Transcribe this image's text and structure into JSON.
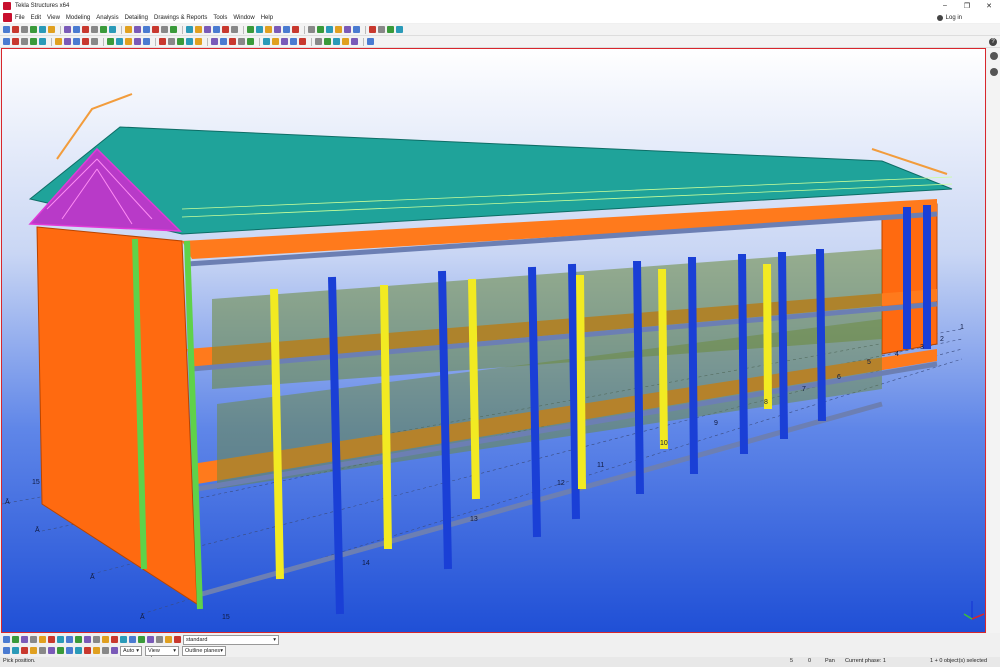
{
  "window": {
    "title": "Tekla Structures x64",
    "controls": [
      "–",
      "❐",
      "✕"
    ]
  },
  "menu": {
    "items": [
      "File",
      "Edit",
      "View",
      "Modeling",
      "Analysis",
      "Detailing",
      "Drawings & Reports",
      "Tools",
      "Window",
      "Help"
    ],
    "login_label": "Log in"
  },
  "bottom": {
    "view_filter": "standard",
    "snap_mode": "Auto",
    "plane": "View plane",
    "outline": "Outline planes"
  },
  "status": {
    "left": "Pick position.",
    "snap_count": "5",
    "zero": "0",
    "mode": "Pan",
    "phase": "Current phase: 1",
    "selection": "1 + 0 object(s) selected"
  },
  "grid_labels": {
    "right": [
      "1",
      "2",
      "3",
      "4",
      "5",
      "6",
      "7",
      "8",
      "9",
      "10",
      "11",
      "12",
      "13",
      "14",
      "15"
    ],
    "left": [
      "15",
      "Ā",
      "Ā",
      "Ā",
      "Ā"
    ]
  },
  "colors": {
    "accent_red": "#d8272d",
    "roof": "#1fa39a",
    "wall": "#ff6a10",
    "column_blue": "#1a3fd6",
    "column_yellow": "#f2ea22",
    "beam_green": "#5fd24a",
    "truss_magenta": "#e03ad8"
  }
}
